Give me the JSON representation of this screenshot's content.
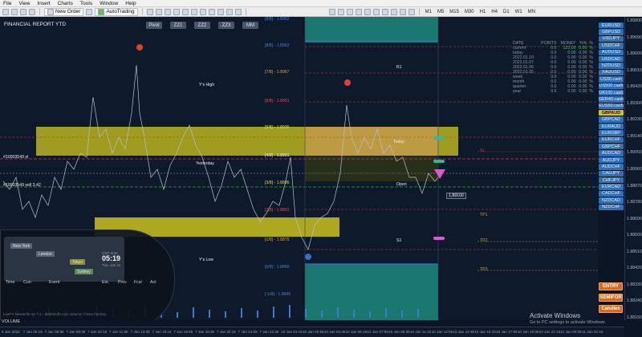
{
  "menu": [
    "File",
    "View",
    "Insert",
    "Charts",
    "Tools",
    "Window",
    "Help"
  ],
  "toolbar": {
    "new_order": "New Order",
    "autotrading": "AutoTrading",
    "timeframes": [
      "M1",
      "M5",
      "M15",
      "M30",
      "H1",
      "H4",
      "D1",
      "W1",
      "MN"
    ]
  },
  "chart": {
    "title": "FINANCIAL REPORT YTD",
    "periods": [
      "Pivot",
      "ZZ1",
      "ZZ2",
      "ZZ3",
      "MM"
    ],
    "labels": {
      "ys_high": "Y's High",
      "ys_low": "Y's Low",
      "yesterday": "Yesterday",
      "open": "Open",
      "today": "Today",
      "r1": "R1",
      "s1": "S1",
      "tp1": "TP1",
      "tp2": "TP2",
      "tp3": "TP3",
      "sl": "SL"
    },
    "levels": [
      {
        "label": "[8/8] - 1.8962"
      },
      {
        "label": "[7/8] - 1.8967"
      },
      {
        "label": "[6/8] - 1.8951"
      },
      {
        "label": "[5/8] - 1.8936"
      },
      {
        "label": "[4/8] - 1.8921"
      },
      {
        "label": "[3/8] - 1.8906"
      },
      {
        "label": "[2/8] - 1.8891"
      },
      {
        "label": "[1/8] - 1.8875"
      },
      {
        "label": "[0/8] - 1.8860"
      },
      {
        "label": "[-1/8] - 1.8845"
      }
    ],
    "buy_label": "#10003549 sl",
    "sell_label": "#10003549 sell 3.42",
    "current_price": "1.89100"
  },
  "stats": {
    "headers": [
      "DATE",
      "POINTS",
      "MONEY",
      "%%",
      "%"
    ],
    "rows": [
      [
        "current",
        "0.0",
        "123.00",
        "0.00",
        "%"
      ],
      [
        "today",
        "0.0",
        "0.00",
        "0.00",
        "%"
      ],
      [
        "2022.01.10",
        "0.0",
        "0.00",
        "0.00",
        "%"
      ],
      [
        "2022.01.07",
        "0.0",
        "0.00",
        "0.00",
        "%"
      ],
      [
        "2022.01.06",
        "0.0",
        "0.00",
        "0.00",
        "%"
      ],
      [
        "2022.01.05",
        "0.0",
        "0.00",
        "0.00",
        "%"
      ],
      [
        "week",
        "0.0",
        "0.00",
        "0.00",
        "%"
      ],
      [
        "month",
        "0.0",
        "0.00",
        "0.00",
        "%"
      ],
      [
        "quarter",
        "0.0",
        "0.00",
        "0.00",
        "%"
      ],
      [
        "year",
        "0.0",
        "0.00",
        "0.00",
        "%"
      ]
    ]
  },
  "symbols": [
    "EURUSD",
    "GBPUSD",
    "USDJPY",
    "USDCHF",
    "AUDUSD",
    "USDCAD",
    "NZDUSD",
    "XAUUSD",
    "US30.cash",
    "US500.cash",
    "UK100.cash",
    "GER40.cash",
    "EUS50.cash",
    "GBPAUD",
    "GBPCAD",
    "EURAUD",
    "EURGBP",
    "EURCHF",
    "GBPCHF",
    "AUDCAD",
    "AUDJPY",
    "AUDCHF",
    "CADJPY",
    "CHFJPY",
    "EURCAD",
    "CADCHF",
    "NZDCAD",
    "NZDCHF"
  ],
  "active_symbol": "GBPAUD",
  "actions": [
    "ENTRY",
    "SEMIFOR",
    "Candles"
  ],
  "price_axis": [
    "1.89800",
    "1.89690",
    "1.89600",
    "1.89510",
    "1.89420",
    "1.89300",
    "1.89230",
    "1.89140",
    "1.89050",
    "1.88960",
    "1.88870",
    "1.88780",
    "1.88690",
    "1.88600",
    "1.88510",
    "1.88420",
    "1.88330",
    "1.88240",
    "1.88150"
  ],
  "time_axis": [
    "6 Jan 2022",
    "7 Jan 05:15",
    "7 Jan 06:55",
    "7 Jan 08:35",
    "7 Jan 10:15",
    "7 Jan 11:55",
    "7 Jan 13:35",
    "7 Jan 15:15",
    "7 Jan 16:55",
    "7 Jan 18:35",
    "7 Jan 20:15",
    "7 Jan 21:55",
    "7 Jan 23:35",
    "10 Jan 01:15",
    "10 Jan 02:55",
    "10 Jan 04:35",
    "10 Jan 06:15",
    "10 Jan 07:55",
    "10 Jan 09:35",
    "10 Jan 11:15",
    "10 Jan 12:55",
    "10 Jan 14:35",
    "10 Jan 16:15",
    "10 Jan 17:55",
    "10 Jan 19:35",
    "10 Jan 21:15",
    "11 Jan 00:35",
    "11 Jan 02:15"
  ],
  "clock": {
    "cities": [
      "New York",
      "London",
      "Tokyo",
      "Sydney"
    ],
    "gmt_label": "GMT time",
    "time": "05:19",
    "date": "Tue, Jan 11",
    "calendar_headers": [
      "Time",
      "Curr.",
      "Event",
      "Est.",
      "Prev",
      "Fcst",
      "Act"
    ]
  },
  "volume_label": "VOLUME",
  "footer_credit": "LuxFX NewsInfo v2.7.1 - deltrisroth.com      Source: Forex Factory",
  "watermark": {
    "title": "Activate Windows",
    "subtitle": "Go to PC settings to activate Windows."
  },
  "colors": {
    "zone_yellow": "#c9c21e",
    "teal": "#1c8a7e",
    "level_blue": "#3c6cc4",
    "level_red": "#c2403c",
    "arrow_magenta": "#e455d4"
  }
}
